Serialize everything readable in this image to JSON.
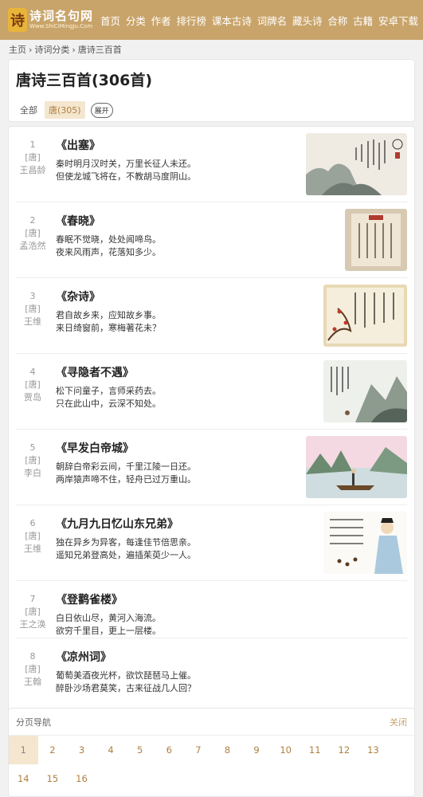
{
  "site": {
    "logo_mark": "诗",
    "logo_title": "诗词名句网",
    "logo_sub": "Www.ShiCiMingJu.Com"
  },
  "nav": [
    "首页",
    "分类",
    "作者",
    "排行榜",
    "课本古诗",
    "词牌名",
    "藏头诗",
    "合称",
    "古籍",
    "安卓下载"
  ],
  "breadcrumb": [
    "主页",
    "诗词分类",
    "唐诗三百首"
  ],
  "page_title": "唐诗三百首(306首)",
  "filters": {
    "all": "全部",
    "tang": "唐(305)",
    "expand": "展开"
  },
  "poems": [
    {
      "num": "1",
      "dynasty": "[唐]",
      "author": "王昌龄",
      "title": "《出塞》",
      "lines": [
        "秦时明月汉时关，万里长征人未还。",
        "但使龙城飞将在，不教胡马度阴山。"
      ]
    },
    {
      "num": "2",
      "dynasty": "[唐]",
      "author": "孟浩然",
      "title": "《春晓》",
      "lines": [
        "春眠不觉晓，处处闻啼鸟。",
        "夜来风雨声，花落知多少。"
      ]
    },
    {
      "num": "3",
      "dynasty": "[唐]",
      "author": "王维",
      "title": "《杂诗》",
      "lines": [
        "君自故乡来，应知故乡事。",
        "来日绮窗前，寒梅著花未？"
      ]
    },
    {
      "num": "4",
      "dynasty": "[唐]",
      "author": "贾岛",
      "title": "《寻隐者不遇》",
      "lines": [
        "松下问童子，言师采药去。",
        "只在此山中，云深不知处。"
      ]
    },
    {
      "num": "5",
      "dynasty": "[唐]",
      "author": "李白",
      "title": "《早发白帝城》",
      "lines": [
        "朝辞白帝彩云间，千里江陵一日还。",
        "两岸猿声啼不住，轻舟已过万重山。"
      ]
    },
    {
      "num": "6",
      "dynasty": "[唐]",
      "author": "王维",
      "title": "《九月九日忆山东兄弟》",
      "lines": [
        "独在异乡为异客，每逢佳节倍思亲。",
        "遥知兄弟登高处，遍插茱萸少一人。"
      ]
    },
    {
      "num": "7",
      "dynasty": "[唐]",
      "author": "王之涣",
      "title": "《登鹳雀楼》",
      "lines": [
        "白日依山尽，黄河入海流。",
        "欲穷千里目，更上一层楼。"
      ]
    },
    {
      "num": "8",
      "dynasty": "[唐]",
      "author": "王翰",
      "title": "《凉州词》",
      "lines": [
        "葡萄美酒夜光杯，欲饮琵琶马上催。",
        "醉卧沙场君莫笑，古来征战几人回？"
      ]
    }
  ],
  "pager": {
    "label": "分页导航",
    "close": "关闭",
    "current": "1",
    "pages": [
      "1",
      "2",
      "3",
      "4",
      "5",
      "6",
      "7",
      "8",
      "9",
      "10",
      "11",
      "12",
      "13",
      "14",
      "15",
      "16"
    ]
  },
  "colors": {
    "brand": "#c9a46a",
    "active_bg": "#f4e6cf",
    "link": "#b08040"
  }
}
